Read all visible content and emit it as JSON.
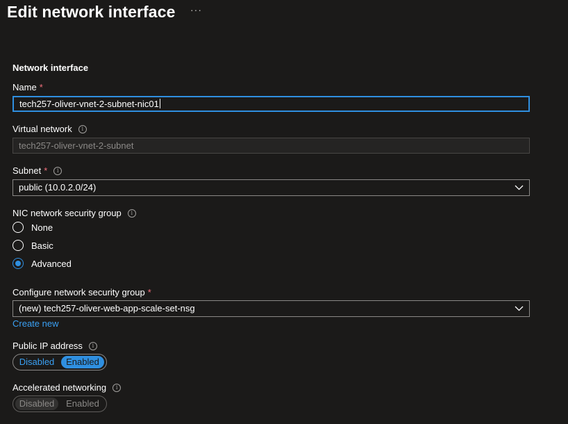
{
  "header": {
    "title": "Edit network interface",
    "more_label": "···"
  },
  "section": {
    "title": "Network interface"
  },
  "name_field": {
    "label": "Name",
    "required": "*",
    "value": "tech257-oliver-vnet-2-subnet-nic01"
  },
  "virtual_network": {
    "label": "Virtual network",
    "info": "i",
    "value": "tech257-oliver-vnet-2-subnet"
  },
  "subnet": {
    "label": "Subnet",
    "required": "*",
    "info": "i",
    "selected": "public (10.0.2.0/24)"
  },
  "nsg": {
    "label": "NIC network security group",
    "info": "i",
    "options": [
      "None",
      "Basic",
      "Advanced"
    ],
    "selected": "Advanced"
  },
  "configure_nsg": {
    "label": "Configure network security group",
    "required": "*",
    "selected": "(new) tech257-oliver-web-app-scale-set-nsg",
    "create_new": "Create new"
  },
  "public_ip": {
    "label": "Public IP address",
    "info": "i",
    "off_label": "Disabled",
    "on_label": "Enabled",
    "state": "Enabled"
  },
  "accelerated": {
    "label": "Accelerated networking",
    "info": "i",
    "off_label": "Disabled",
    "on_label": "Enabled",
    "state": "Disabled",
    "disabled": true
  },
  "colors": {
    "background": "#1b1a19",
    "accent": "#2f8fe0",
    "link": "#3aa0f3",
    "required": "#f1707b"
  }
}
